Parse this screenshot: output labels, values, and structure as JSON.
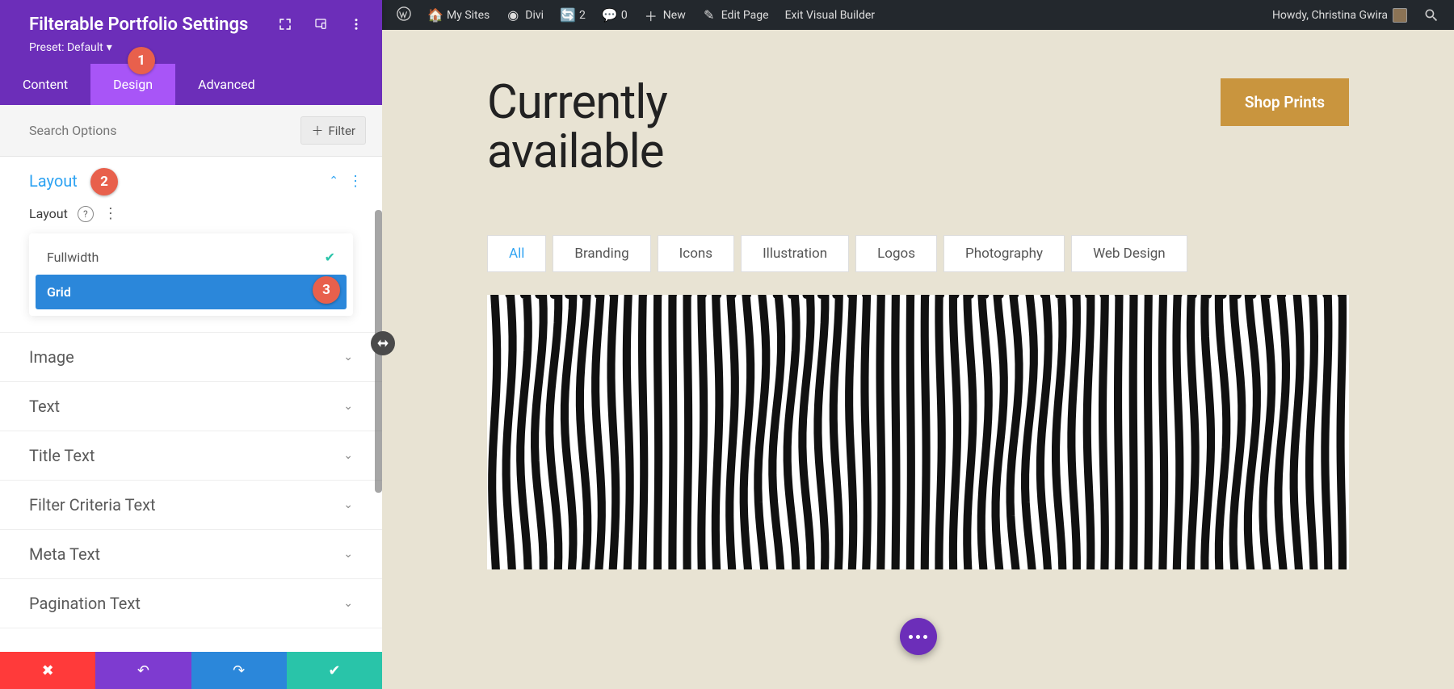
{
  "wp_bar": {
    "my_sites": "My Sites",
    "divi": "Divi",
    "updates": "2",
    "comments": "0",
    "new": "New",
    "edit": "Edit Page",
    "exit": "Exit Visual Builder",
    "howdy": "Howdy, Christina Gwira"
  },
  "panel": {
    "title": "Filterable Portfolio Settings",
    "preset": "Preset: Default",
    "tabs": {
      "content": "Content",
      "design": "Design",
      "advanced": "Advanced"
    },
    "search_placeholder": "Search Options",
    "filter_btn": "Filter",
    "sections": {
      "layout": "Layout",
      "image": "Image",
      "text": "Text",
      "title_text": "Title Text",
      "filter_criteria": "Filter Criteria Text",
      "meta_text": "Meta Text",
      "pagination_text": "Pagination Text"
    },
    "layout_label": "Layout",
    "layout_options": {
      "fullwidth": "Fullwidth",
      "grid": "Grid"
    }
  },
  "badges": {
    "b1": "1",
    "b2": "2",
    "b3": "3"
  },
  "preview": {
    "heading_l1": "Currently",
    "heading_l2": "available",
    "shop_btn": "Shop Prints",
    "filters": [
      "All",
      "Branding",
      "Icons",
      "Illustration",
      "Logos",
      "Photography",
      "Web Design"
    ]
  }
}
